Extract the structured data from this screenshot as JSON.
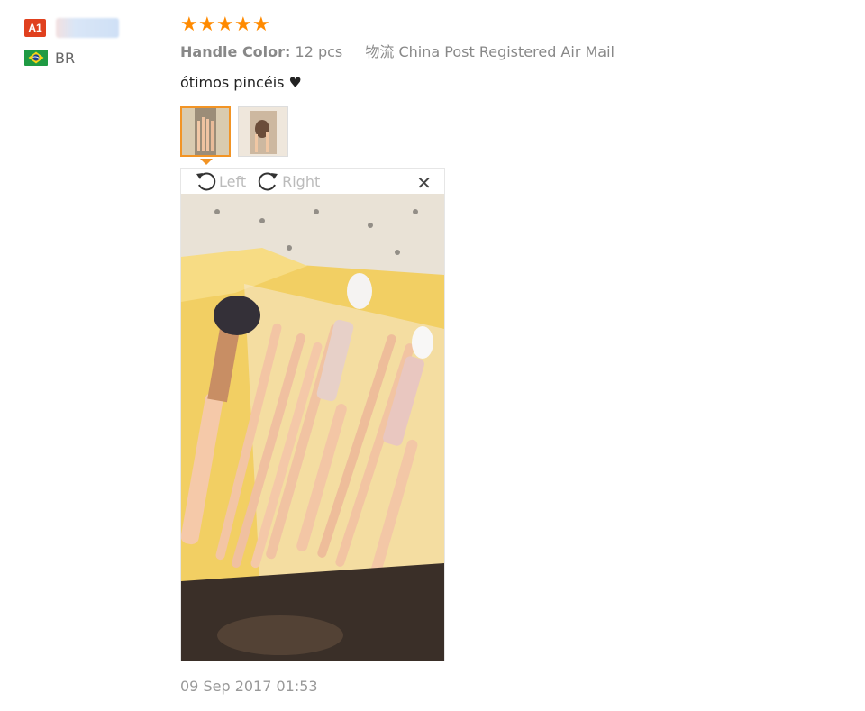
{
  "user": {
    "level_badge": "A1",
    "country_code": "BR",
    "flag_icon": "brazil-flag-icon"
  },
  "review": {
    "rating": 5,
    "stars": "★★★★★",
    "attributes": {
      "handle_color_label": "Handle Color:",
      "handle_color_value": "12 pcs",
      "logistics_label": "物流",
      "logistics_value": "China Post Registered Air Mail"
    },
    "comment": "ótimos pincéis ♥",
    "thumbnails": [
      {
        "name": "photo-1",
        "active": true
      },
      {
        "name": "photo-2",
        "active": false
      }
    ],
    "viewer": {
      "rotate_left_label": "Left",
      "rotate_right_label": "Right",
      "close_label": "✕"
    },
    "date": "09 Sep 2017 01:53"
  },
  "colors": {
    "star": "#ff8a00",
    "badge": "#e0401e",
    "thumb_active_border": "#f29425"
  }
}
